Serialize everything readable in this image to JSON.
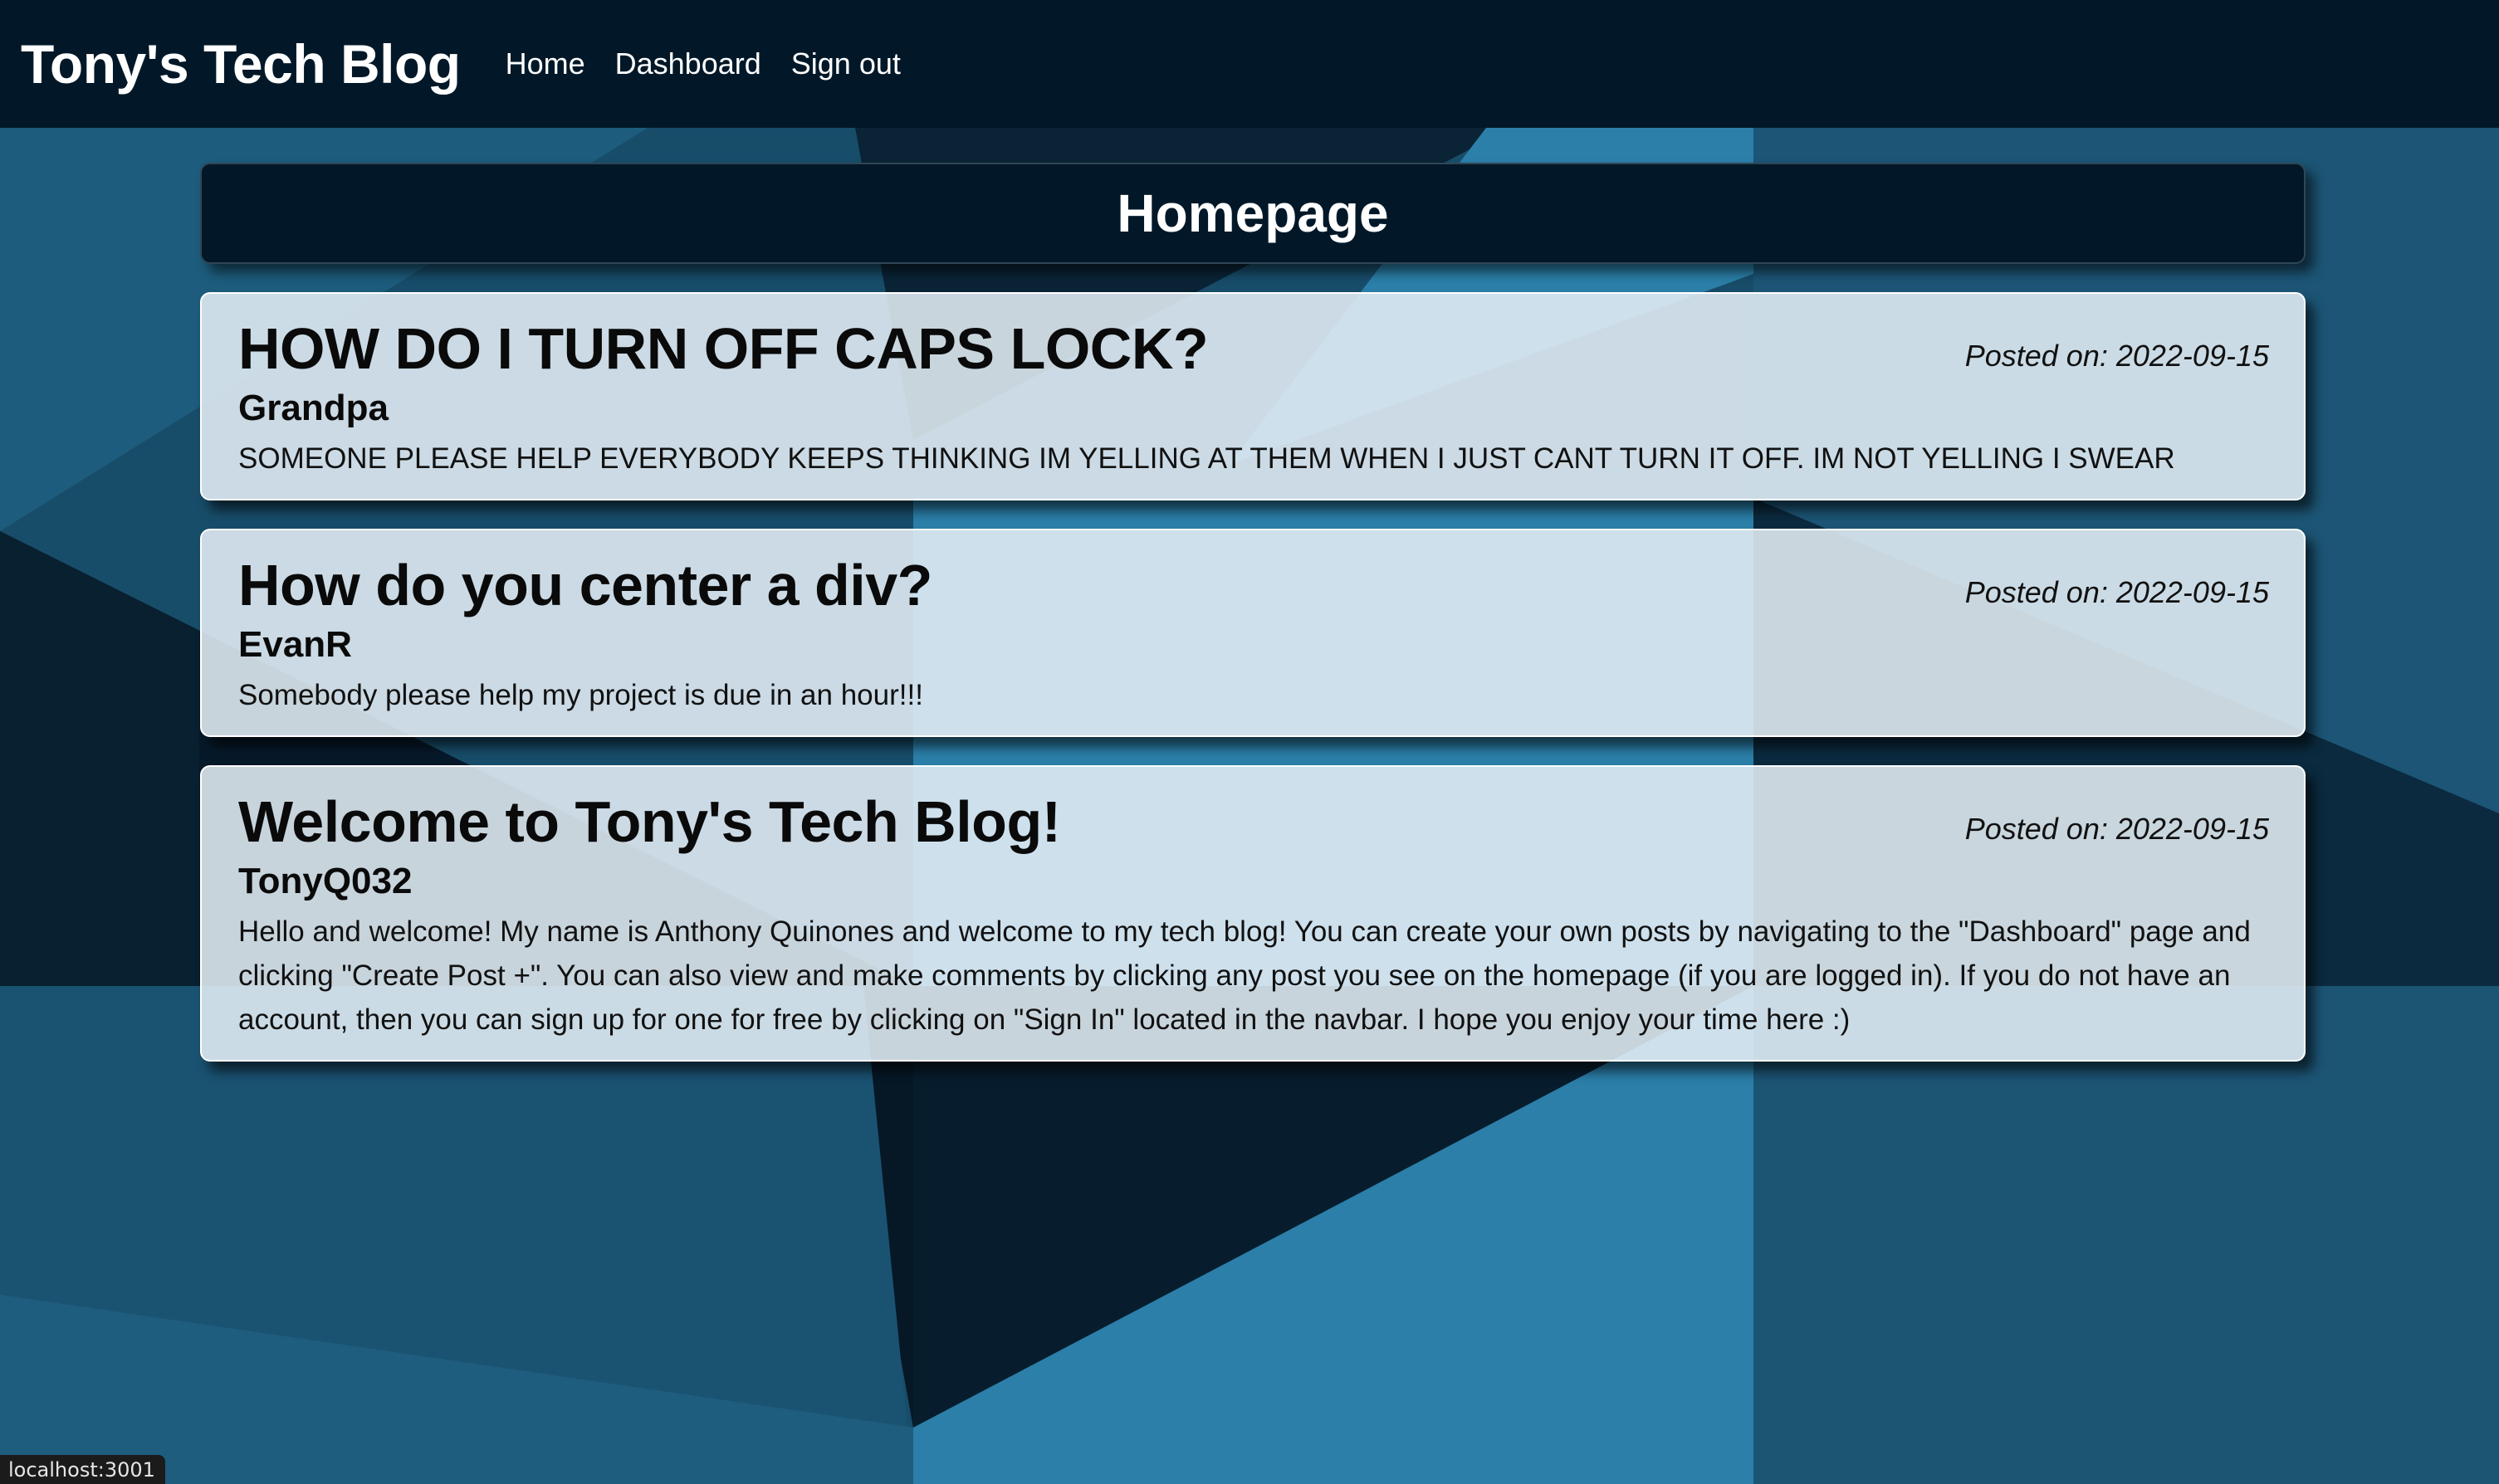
{
  "navbar": {
    "brand": "Tony's Tech Blog",
    "links": [
      "Home",
      "Dashboard",
      "Sign out"
    ]
  },
  "page": {
    "title": "Homepage"
  },
  "posts": [
    {
      "title": "HOW DO I TURN OFF CAPS LOCK?",
      "date": "Posted on: 2022-09-15",
      "author": "Grandpa",
      "body": "SOMEONE PLEASE HELP EVERYBODY KEEPS THINKING IM YELLING AT THEM WHEN I JUST CANT TURN IT OFF. IM NOT YELLING I SWEAR"
    },
    {
      "title": "How do you center a div?",
      "date": "Posted on: 2022-09-15",
      "author": "EvanR",
      "body": "Somebody please help my project is due in an hour!!!"
    },
    {
      "title": "Welcome to Tony's Tech Blog!",
      "date": "Posted on: 2022-09-15",
      "author": "TonyQ032",
      "body": "Hello and welcome! My name is Anthony Quinones and welcome to my tech blog! You can create your own posts by navigating to the \"Dashboard\" page and clicking \"Create Post +\". You can also view and make comments by clicking any post you see on the homepage (if you are logged in). If you do not have an account, then you can sign up for one for free by clicking on \"Sign In\" located in the navbar. I hope you enjoy your time here :)"
    }
  ],
  "status_bar": {
    "url": "localhost:3001"
  },
  "colors": {
    "navbar_bg": "#021828",
    "card_bg": "#e4eef5",
    "bg_dark": "#0b2538",
    "bg_mid": "#1b5370",
    "bg_light": "#2a7fa8"
  }
}
